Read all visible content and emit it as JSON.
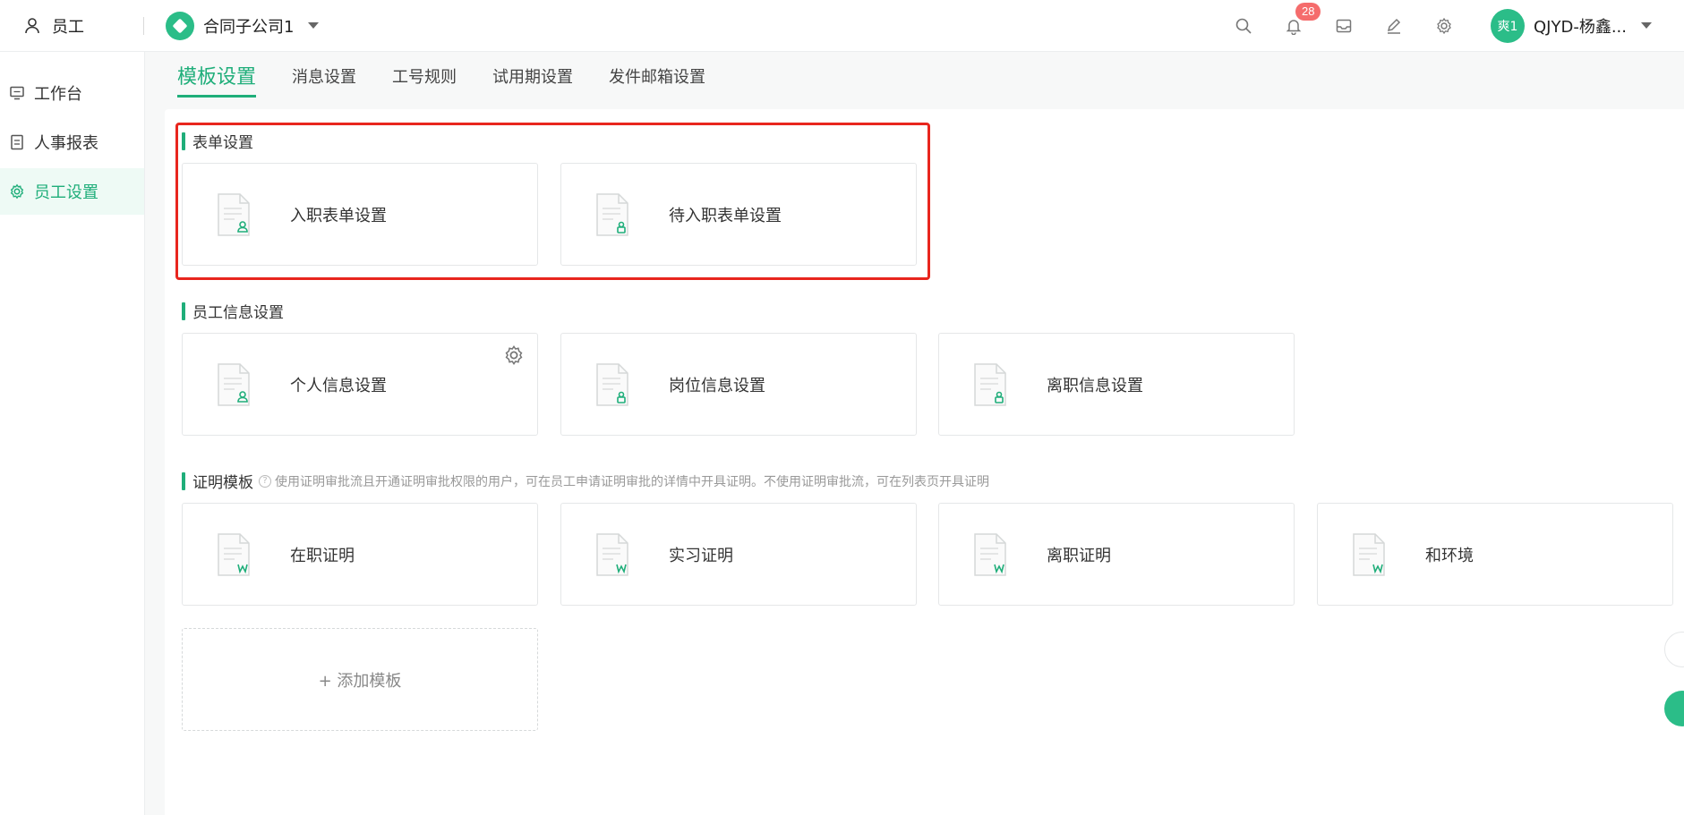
{
  "topbar": {
    "module_label": "员工",
    "company_name": "合同子公司1",
    "notification_count": "28",
    "user_avatar_text": "爽1",
    "user_name": "QJYD-杨鑫..."
  },
  "sidebar": {
    "items": [
      {
        "label": "工作台"
      },
      {
        "label": "人事报表"
      },
      {
        "label": "员工设置"
      }
    ]
  },
  "tabs": [
    {
      "label": "模板设置"
    },
    {
      "label": "消息设置"
    },
    {
      "label": "工号规则"
    },
    {
      "label": "试用期设置"
    },
    {
      "label": "发件邮箱设置"
    }
  ],
  "sections": {
    "form": {
      "title": "表单设置",
      "cards": [
        {
          "label": "入职表单设置"
        },
        {
          "label": "待入职表单设置"
        }
      ]
    },
    "info": {
      "title": "员工信息设置",
      "cards": [
        {
          "label": "个人信息设置"
        },
        {
          "label": "岗位信息设置"
        },
        {
          "label": "离职信息设置"
        }
      ]
    },
    "cert": {
      "title": "证明模板",
      "note": "使用证明审批流且开通证明审批权限的用户，可在员工申请证明审批的详情中开具证明。不使用证明审批流，可在列表页开具证明",
      "cards": [
        {
          "label": "在职证明"
        },
        {
          "label": "实习证明"
        },
        {
          "label": "离职证明"
        },
        {
          "label": "和环境"
        }
      ],
      "add_label": "+ 添加模板"
    }
  },
  "colors": {
    "accent": "#1fae7a",
    "highlight": "#e8261e",
    "badge": "#f56c6c"
  }
}
